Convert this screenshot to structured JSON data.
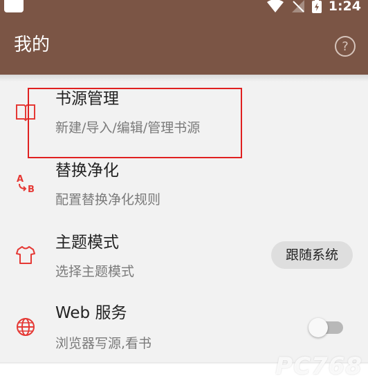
{
  "status_bar": {
    "time": "1:24",
    "icons": [
      "wifi-icon",
      "signal-icon",
      "battery-icon"
    ]
  },
  "app_bar": {
    "title": "我的",
    "help_icon": "help-circle-icon",
    "help_glyph": "?"
  },
  "settings": [
    {
      "id": "book-source",
      "title": "书源管理",
      "summary": "新建/导入/编辑/管理书源",
      "icon": "book-open-icon"
    },
    {
      "id": "replace-rules",
      "title": "替换净化",
      "summary": "配置替换净化规则",
      "icon": "ab-replace-icon",
      "icon_text_a": "A",
      "icon_text_b": "B"
    },
    {
      "id": "theme-mode",
      "title": "主题模式",
      "summary": "选择主题模式",
      "icon": "tshirt-icon",
      "value": "跟随系统"
    },
    {
      "id": "web-service",
      "title": "Web 服务",
      "summary": "浏览器写源,看书",
      "icon": "globe-icon",
      "toggle_on": false
    }
  ],
  "watermark": "PC768",
  "colors": {
    "toolbar": "#7b5545",
    "accent_icon": "#e53935",
    "highlight_box": "#e02020",
    "background": "#f2f2f2"
  }
}
